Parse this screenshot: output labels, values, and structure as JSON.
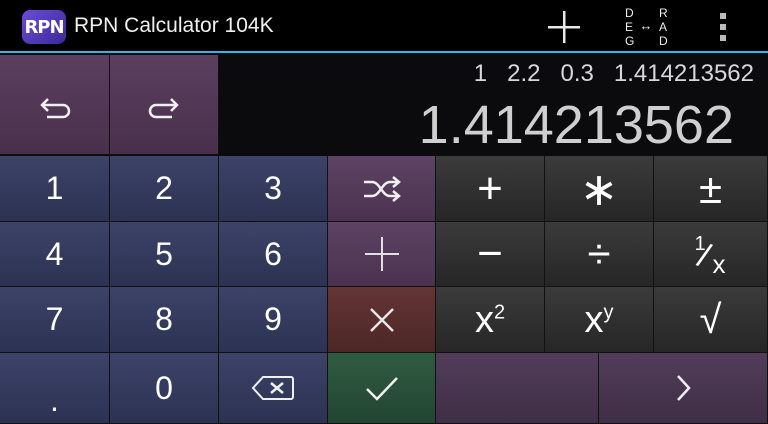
{
  "app": {
    "logo": "RPN",
    "title": "RPN Calculator 104K",
    "mode_left": [
      "D",
      "E",
      "G"
    ],
    "mode_right": [
      "R",
      "A",
      "D"
    ],
    "mode_arrow": "↔"
  },
  "display": {
    "stack": "1   2.2   0.3   1.414213562",
    "value": "1.414213562"
  },
  "keys": {
    "digits": [
      "1",
      "2",
      "3",
      "4",
      "5",
      "6",
      "7",
      "8",
      "9",
      ".",
      "0"
    ],
    "ops": {
      "add": "+",
      "mul": "∗",
      "neg": "±",
      "sub": "−",
      "div": "÷",
      "inv_num": "1",
      "inv_den": "x",
      "sq_base": "x",
      "sq_exp": "2",
      "pow_base": "x",
      "pow_exp": "y",
      "sqrt": "√"
    }
  },
  "colors": {
    "accent": "#33b5e5",
    "digit_key": "#353b5e",
    "undo_key": "#523856",
    "operator_key": "#303030",
    "clear_key": "#582d2d",
    "enter_key": "#29503a"
  },
  "icons": [
    "undo-icon",
    "redo-icon",
    "add-icon",
    "deg-rad-toggle",
    "overflow-menu-icon",
    "swap-icon",
    "enter-icon",
    "clear-icon",
    "backspace-icon",
    "check-icon",
    "chevron-right-icon"
  ]
}
